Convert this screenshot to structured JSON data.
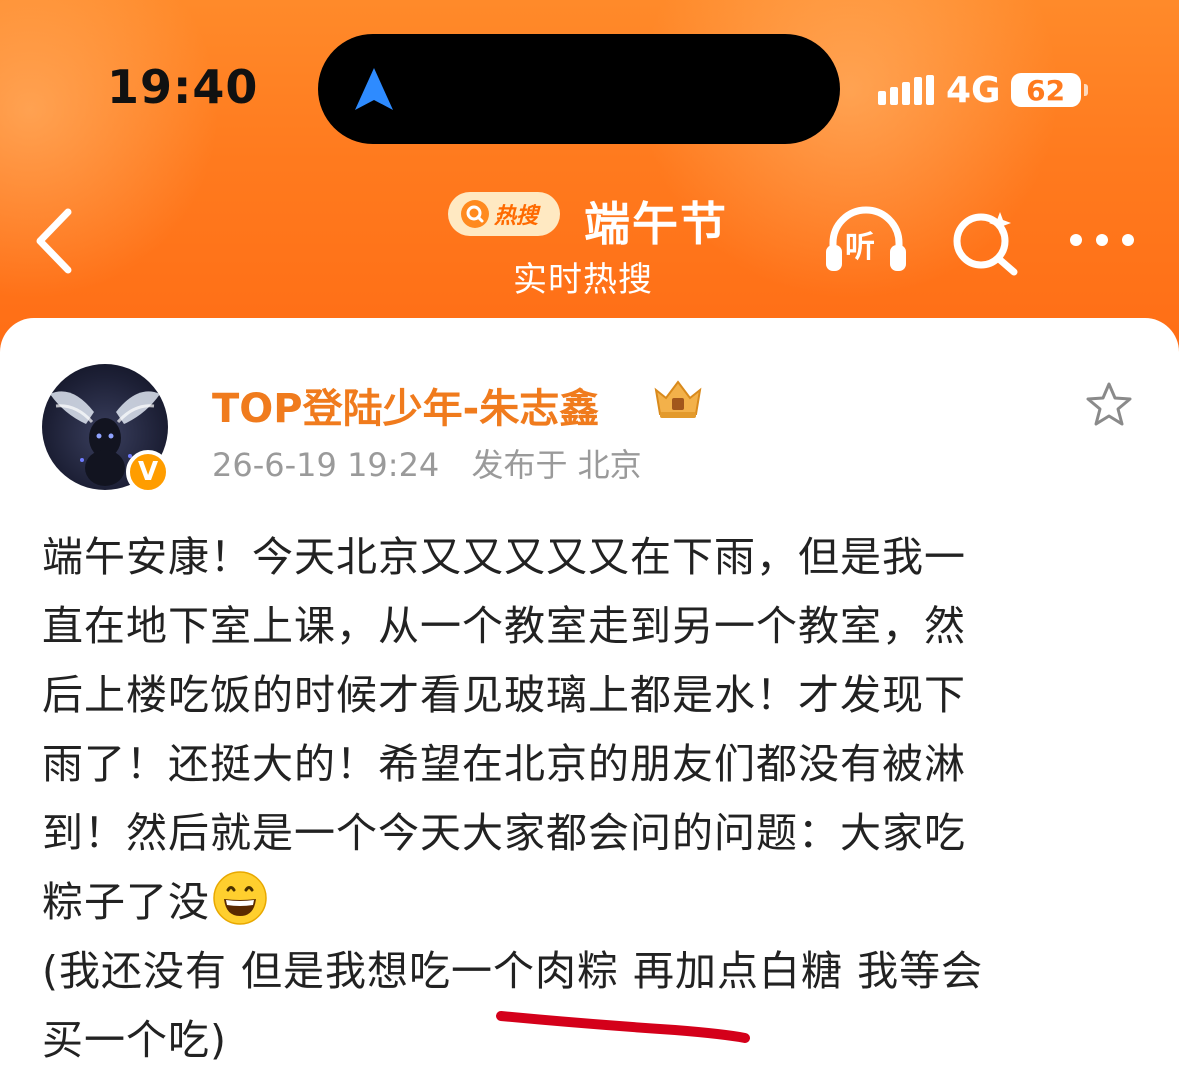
{
  "status_bar": {
    "time": "19:40",
    "network": "4G",
    "battery": "62"
  },
  "header": {
    "hot_badge_label": "热搜",
    "topic_title": "端午节",
    "topic_subtitle": "实时热搜",
    "listen_label": "听",
    "icons": [
      "back-arrow-icon",
      "headphones-icon",
      "search-sparkle-icon",
      "more-dots-icon"
    ],
    "accent_color": "#ff7a1e"
  },
  "post": {
    "author": "TOP登陆少年-朱志鑫",
    "verified_label": "V",
    "time": "26-6-19 19:24",
    "location": "发布于 北京",
    "lines": [
      "端午安康！今天北京又又又又又在下雨，但是我一",
      "直在地下室上课，从一个教室走到另一个教室，然",
      "后上楼吃饭的时候才看见玻璃上都是水！才发现下",
      "雨了！还挺大的！希望在北京的朋友们都没有被淋",
      "到！然后就是一个今天大家都会问的问题：大家吃",
      "粽子了没",
      "(我还没有 但是我想吃一个肉粽 再加点白糖 我等会",
      "买一个吃)"
    ],
    "author_color": "#f07b1d"
  }
}
